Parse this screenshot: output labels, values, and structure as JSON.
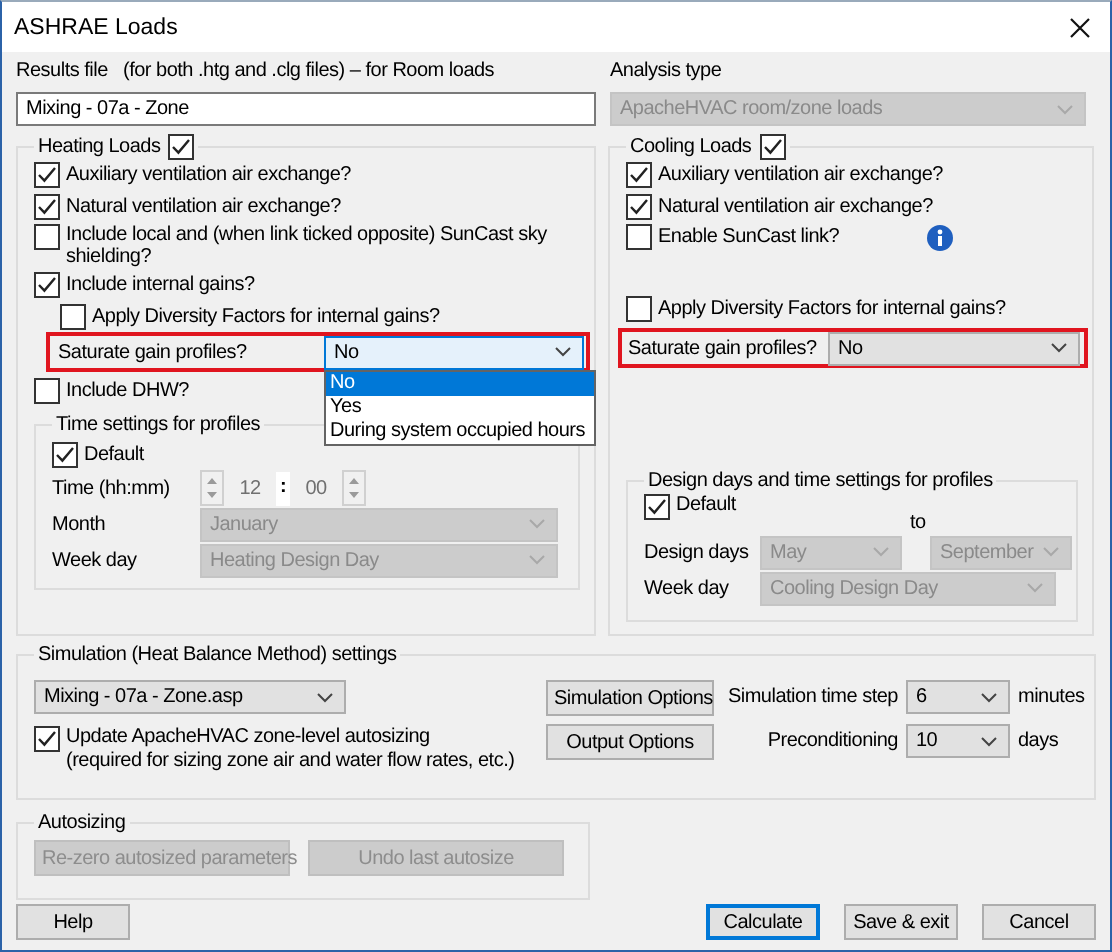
{
  "window": {
    "title": "ASHRAE Loads"
  },
  "results_file": {
    "label": "Results file   (for both .htg and .clg files) – for Room loads",
    "value": "Mixing - 07a - Zone"
  },
  "analysis_type": {
    "label": "Analysis type",
    "combo": {
      "value": "ApacheHVAC room/zone loads",
      "disabled": true,
      "expanded": false
    }
  },
  "heating_loads": {
    "label": "Heating Loads",
    "checked": true,
    "items": [
      {
        "kind": "checkbox",
        "label": "Auxiliary ventilation air exchange?",
        "checked": true
      },
      {
        "kind": "checkbox",
        "label": "Natural ventilation air exchange?",
        "checked": true
      },
      {
        "kind": "checkbox",
        "label": "Include local and (when link ticked opposite) SunCast sky shielding?",
        "checked": false
      },
      {
        "kind": "checkbox",
        "label": "Include internal gains?",
        "checked": true,
        "children": [
          {
            "kind": "checkbox",
            "label": "Apply Diversity Factors for internal gains?",
            "checked": false
          },
          {
            "kind": "combo",
            "label": "Saturate gain profiles?",
            "highlighted": true,
            "combo": {
              "value": "No",
              "disabled": false,
              "expanded": true,
              "options": [
                {
                  "label": "No",
                  "selected": true
                },
                {
                  "label": "Yes",
                  "selected": false
                },
                {
                  "label": "During system occupied hours",
                  "selected": false
                }
              ]
            }
          }
        ]
      },
      {
        "kind": "checkbox",
        "label": "Include DHW?",
        "checked": false
      }
    ],
    "time_settings": {
      "label": "Time settings for profiles",
      "default": {
        "label": "Default",
        "checked": true
      },
      "time": {
        "label": "Time (hh:mm)",
        "hour": "12",
        "separator": ":",
        "minute": "00",
        "disabled": true
      },
      "month": {
        "label": "Month",
        "combo": {
          "value": "January",
          "disabled": true,
          "expanded": false
        }
      },
      "week_day": {
        "label": "Week day",
        "combo": {
          "value": "Heating Design Day",
          "disabled": true,
          "expanded": false
        }
      }
    }
  },
  "cooling_loads": {
    "label": "Cooling Loads",
    "checked": true,
    "items": [
      {
        "kind": "checkbox",
        "label": "Auxiliary ventilation air exchange?",
        "checked": true
      },
      {
        "kind": "checkbox",
        "label": "Natural ventilation air exchange?",
        "checked": true
      },
      {
        "kind": "checkbox",
        "label": "Enable SunCast link?",
        "checked": false,
        "info": true
      },
      {
        "kind": "checkbox",
        "label": "Apply Diversity Factors for internal gains?",
        "checked": false
      },
      {
        "kind": "combo",
        "label": "Saturate gain profiles?",
        "highlighted": true,
        "combo": {
          "value": "No",
          "disabled": false,
          "expanded": false
        }
      }
    ],
    "design_settings": {
      "label": "Design days and time settings for profiles",
      "default": {
        "label": "Default",
        "checked": true
      },
      "to_label": "to",
      "design_days": {
        "label": "Design days",
        "from": {
          "value": "May",
          "disabled": true,
          "expanded": false
        },
        "to": {
          "value": "September",
          "disabled": true,
          "expanded": false
        }
      },
      "week_day": {
        "label": "Week day",
        "combo": {
          "value": "Cooling Design Day",
          "disabled": true,
          "expanded": false
        }
      }
    }
  },
  "simulation": {
    "label": "Simulation (Heat Balance Method) settings",
    "file": {
      "value": "Mixing - 07a - Zone.asp",
      "disabled": false,
      "expanded": false
    },
    "update": {
      "lines": [
        "Update ApacheHVAC zone-level autosizing",
        "(required for sizing zone air and water flow rates, etc.)"
      ],
      "checked": true
    },
    "buttons": [
      {
        "label": "Simulation Options",
        "disabled": false
      },
      {
        "label": "Output Options",
        "disabled": false
      }
    ],
    "settings": [
      {
        "label": "Simulation time step",
        "combo": {
          "value": "6",
          "disabled": false,
          "expanded": false
        },
        "unit": "minutes"
      },
      {
        "label": "Preconditioning",
        "combo": {
          "value": "10",
          "disabled": false,
          "expanded": false
        },
        "unit": "days"
      }
    ]
  },
  "autosizing": {
    "label": "Autosizing",
    "buttons": [
      {
        "label": "Re-zero autosized parameters",
        "disabled": true
      },
      {
        "label": "Undo last autosize",
        "disabled": true
      }
    ]
  },
  "buttons": [
    {
      "label": "Help",
      "default": false,
      "disabled": false
    },
    {
      "label": "Calculate",
      "default": true,
      "disabled": false
    },
    {
      "label": "Save & exit",
      "default": false,
      "disabled": false
    },
    {
      "label": "Cancel",
      "default": false,
      "disabled": false
    }
  ]
}
